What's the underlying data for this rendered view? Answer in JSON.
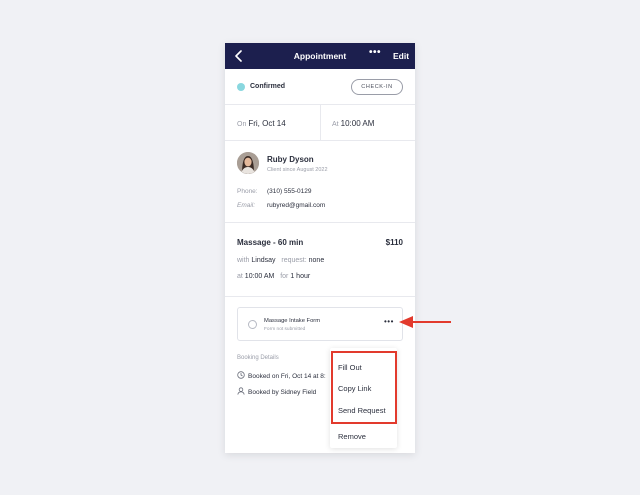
{
  "header": {
    "title": "Appointment",
    "more": "•••",
    "edit": "Edit"
  },
  "status": {
    "label": "Confirmed",
    "checkin": "CHECK-IN",
    "dot_color": "#89d7df"
  },
  "date": {
    "on_label": "On",
    "on_value": "Fri, Oct 14",
    "at_label": "At",
    "at_value": "10:00 AM"
  },
  "client": {
    "name": "Ruby Dyson",
    "since": "Client since August 2022",
    "phone_label": "Phone:",
    "phone": "(310) 555-0129",
    "email_label": "Email:",
    "email": "rubyred@gmail.com"
  },
  "service": {
    "name": "Massage - 60 min",
    "price": "$110",
    "with_label": "with",
    "with_value": "Lindsay",
    "request_label": "request:",
    "request_value": "none",
    "at_label": "at",
    "at_value": "10:00 AM",
    "for_label": "for",
    "for_value": "1 hour"
  },
  "form": {
    "title": "Massage Intake Form",
    "status": "Form not submitted",
    "more": "•••"
  },
  "booking": {
    "heading": "Booking Details",
    "booked_on": "Booked on Fri, Oct 14 at 8:",
    "booked_by": "Booked by Sidney Field"
  },
  "menu": {
    "items": [
      "Fill Out",
      "Copy Link",
      "Send Request",
      "Remove"
    ]
  },
  "annotation": {
    "highlight_color": "#e23a2d"
  },
  "colors": {
    "header_bg": "#1c1f4e",
    "accent": "#89d7df"
  }
}
